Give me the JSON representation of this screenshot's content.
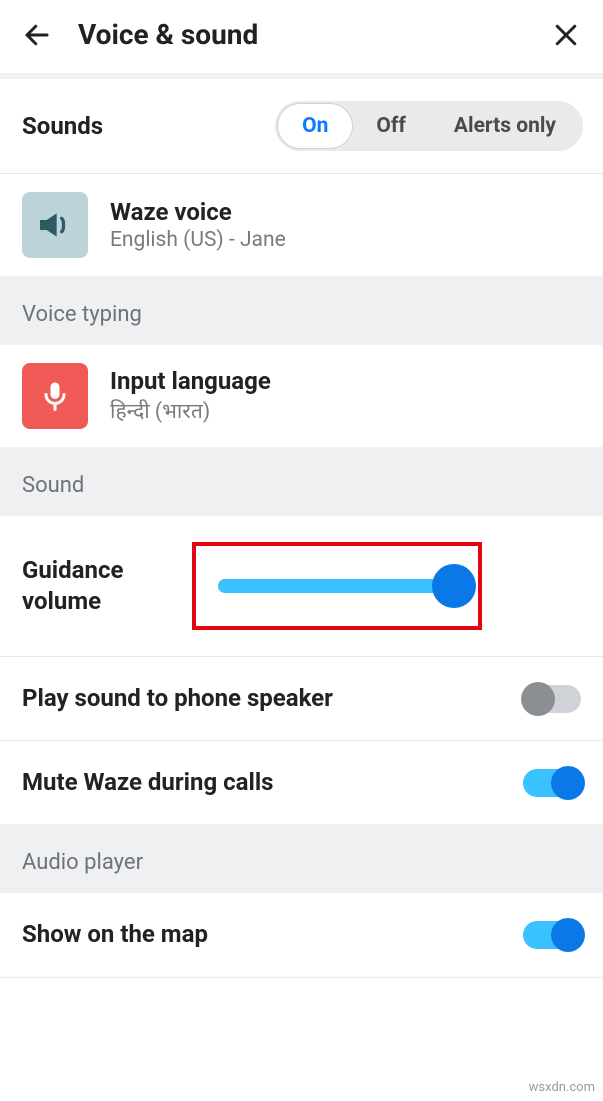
{
  "header": {
    "title": "Voice & sound"
  },
  "sounds": {
    "label": "Sounds",
    "options": [
      "On",
      "Off",
      "Alerts only"
    ],
    "selected_index": 0
  },
  "waze_voice": {
    "title": "Waze voice",
    "subtitle": "English (US) - Jane"
  },
  "voice_typing": {
    "header": "Voice typing",
    "input_language": {
      "title": "Input language",
      "subtitle": "हिन्दी (भारत)"
    }
  },
  "sound_section": {
    "header": "Sound",
    "guidance": {
      "label": "Guidance volume",
      "value_pct": 96
    },
    "play_to_speaker": {
      "label": "Play sound to phone speaker",
      "value": false
    },
    "mute_during_calls": {
      "label": "Mute Waze during calls",
      "value": true
    }
  },
  "audio_player": {
    "header": "Audio player",
    "show_on_map": {
      "label": "Show on the map",
      "value": true
    }
  },
  "watermark": "wsxdn.com"
}
